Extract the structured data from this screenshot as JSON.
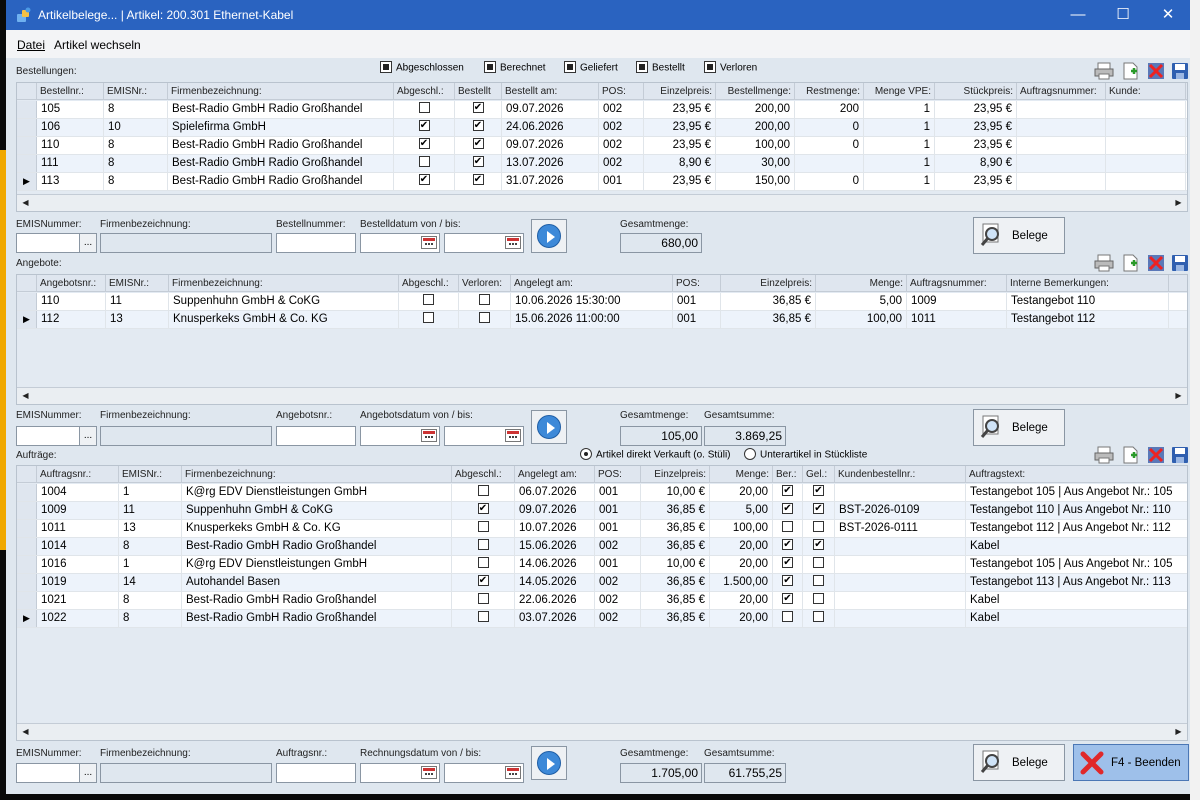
{
  "title": "Artikelbelege... | Artikel: 200.301 Ethernet-Kabel",
  "menu": [
    "Datei",
    "Artikel wechseln"
  ],
  "status_filters": [
    "Abgeschlossen",
    "Berechnet",
    "Geliefert",
    "Bestellt",
    "Verloren"
  ],
  "bestellungen": {
    "label": "Bestellungen:",
    "headers": [
      "Bestellnr.:",
      "EMISNr.:",
      "Firmenbezeichnung:",
      "Abgeschl.:",
      "Bestellt",
      "Bestellt am:",
      "POS:",
      "Einzelpreis:",
      "Bestellmenge:",
      "Restmenge:",
      "Menge VPE:",
      "Stückpreis:",
      "Auftragsnummer:",
      "Kunde:"
    ],
    "rows": [
      [
        "105",
        "8",
        "Best-Radio GmbH Radio Großhandel",
        false,
        true,
        "09.07.2026",
        "002",
        "23,95 €",
        "200,00",
        "200",
        "1",
        "23,95 €",
        "",
        ""
      ],
      [
        "106",
        "10",
        "Spielefirma GmbH",
        true,
        true,
        "24.06.2026",
        "002",
        "23,95 €",
        "200,00",
        "0",
        "1",
        "23,95 €",
        "",
        ""
      ],
      [
        "110",
        "8",
        "Best-Radio GmbH Radio Großhandel",
        true,
        true,
        "09.07.2026",
        "002",
        "23,95 €",
        "100,00",
        "0",
        "1",
        "23,95 €",
        "",
        ""
      ],
      [
        "111",
        "8",
        "Best-Radio GmbH Radio Großhandel",
        false,
        true,
        "13.07.2026",
        "002",
        "8,90 €",
        "30,00",
        "",
        "1",
        "8,90 €",
        "",
        ""
      ],
      [
        "113",
        "8",
        "Best-Radio GmbH Radio Großhandel",
        true,
        true,
        "31.07.2026",
        "001",
        "23,95 €",
        "150,00",
        "0",
        "1",
        "23,95 €",
        "",
        ""
      ]
    ],
    "filter_labels": [
      "EMISNummer:",
      "Firmenbezeichnung:",
      "Bestellnummer:",
      "Bestelldatum von / bis:",
      "Gesamtmenge:"
    ],
    "gesamtmenge": "680,00"
  },
  "angebote": {
    "label": "Angebote:",
    "headers": [
      "Angebotsnr.:",
      "EMISNr.:",
      "Firmenbezeichnung:",
      "Abgeschl.:",
      "Verloren:",
      "Angelegt am:",
      "POS:",
      "Einzelpreis:",
      "Menge:",
      "Auftragsnummer:",
      "Interne Bemerkungen:"
    ],
    "rows": [
      [
        "110",
        "11",
        "Suppenhuhn GmbH & CoKG",
        false,
        false,
        "10.06.2026 15:30:00",
        "001",
        "36,85 €",
        "5,00",
        "1009",
        "Testangebot 110"
      ],
      [
        "112",
        "13",
        "Knusperkeks GmbH & Co. KG",
        false,
        false,
        "15.06.2026 11:00:00",
        "001",
        "36,85 €",
        "100,00",
        "1011",
        "Testangebot 112"
      ]
    ],
    "filter_labels": [
      "EMISNummer:",
      "Firmenbezeichnung:",
      "Angebotsnr.:",
      "Angebotsdatum von / bis:",
      "Gesamtmenge:",
      "Gesamtsumme:"
    ],
    "gesamtmenge": "105,00",
    "gesamtsumme": "3.869,25"
  },
  "auftraege": {
    "label": "Aufträge:",
    "radio_options": [
      "Artikel direkt Verkauft (o. Stüli)",
      "Unterartikel in Stückliste"
    ],
    "headers": [
      "Auftragsnr.:",
      "EMISNr.:",
      "Firmenbezeichnung:",
      "Abgeschl.:",
      "Angelegt am:",
      "POS:",
      "Einzelpreis:",
      "Menge:",
      "Ber.:",
      "Gel.:",
      "Kundenbestellnr.:",
      "Auftragstext:"
    ],
    "rows": [
      [
        "1004",
        "1",
        "K@rg EDV Dienstleistungen GmbH",
        false,
        "06.07.2026",
        "001",
        "10,00 €",
        "20,00",
        true,
        true,
        "",
        "Testangebot 105 | Aus Angebot Nr.: 105"
      ],
      [
        "1009",
        "11",
        "Suppenhuhn GmbH & CoKG",
        true,
        "09.07.2026",
        "001",
        "36,85 €",
        "5,00",
        true,
        true,
        "BST-2026-0109",
        "Testangebot 110 | Aus Angebot Nr.: 110"
      ],
      [
        "1011",
        "13",
        "Knusperkeks GmbH & Co. KG",
        false,
        "10.07.2026",
        "001",
        "36,85 €",
        "100,00",
        false,
        false,
        "BST-2026-0111",
        "Testangebot 112 | Aus Angebot Nr.: 112"
      ],
      [
        "1014",
        "8",
        "Best-Radio GmbH Radio Großhandel",
        false,
        "15.06.2026",
        "002",
        "36,85 €",
        "20,00",
        true,
        true,
        "",
        "Kabel"
      ],
      [
        "1016",
        "1",
        "K@rg EDV Dienstleistungen GmbH",
        false,
        "14.06.2026",
        "001",
        "10,00 €",
        "20,00",
        true,
        false,
        "",
        "Testangebot 105 | Aus Angebot Nr.: 105"
      ],
      [
        "1019",
        "14",
        "Autohandel Basen",
        true,
        "14.05.2026",
        "002",
        "36,85 €",
        "1.500,00",
        true,
        false,
        "",
        "Testangebot 113 | Aus Angebot Nr.: 113"
      ],
      [
        "1021",
        "8",
        "Best-Radio GmbH Radio Großhandel",
        false,
        "22.06.2026",
        "002",
        "36,85 €",
        "20,00",
        true,
        false,
        "",
        "Kabel"
      ],
      [
        "1022",
        "8",
        "Best-Radio GmbH Radio Großhandel",
        false,
        "03.07.2026",
        "002",
        "36,85 €",
        "20,00",
        false,
        false,
        "",
        "Kabel"
      ]
    ],
    "filter_labels": [
      "EMISNummer:",
      "Firmenbezeichnung:",
      "Auftragsnr.:",
      "Rechnungsdatum von / bis:",
      "Gesamtmenge:",
      "Gesamtsumme:"
    ],
    "gesamtmenge": "1.705,00",
    "gesamtsumme": "61.755,25"
  },
  "buttons": {
    "belege": "Belege",
    "beenden": "F4 - Beenden",
    "dots": "..."
  },
  "colors": {
    "titlebar": "#2a63c0",
    "window": "#dfe7ef",
    "row_alt": "#edf3fb",
    "beenden_bg": "#9ec0ea"
  }
}
